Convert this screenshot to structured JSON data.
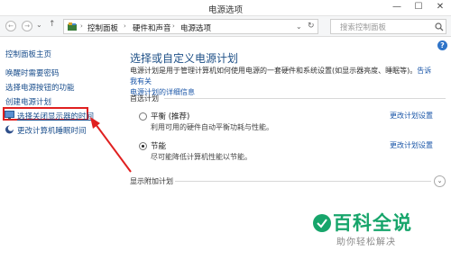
{
  "window": {
    "title": "电源选项",
    "minimize": "—",
    "maximize": "☐",
    "close": "✕"
  },
  "address_bar": {
    "back": "←",
    "forward": "→",
    "history": "⌄",
    "up": "↑",
    "breadcrumbs": [
      "控制面板",
      "硬件和声音",
      "电源选项"
    ],
    "search_placeholder": "搜索控制面板"
  },
  "sidebar": {
    "home": "控制面板主页",
    "items": [
      {
        "label": "唤醒时需要密码"
      },
      {
        "label": "选择电源按钮的功能"
      },
      {
        "label": "创建电源计划"
      },
      {
        "label": "选择关闭显示器的时间"
      },
      {
        "label": "更改计算机睡眠时间"
      }
    ]
  },
  "main": {
    "title": "选择或自定义电源计划",
    "desc_line1": "电源计划是用于管理计算机如何使用电源的一套硬件和系统设置(如显示器亮度、睡眠等)。",
    "desc_link1": "告诉我有关",
    "desc_link2": "电源计划的详细信息",
    "preferred_section": "首选计划",
    "plans": [
      {
        "name": "平衡 (推荐)",
        "desc": "利用可用的硬件自动平衡功耗与性能。",
        "link": "更改计划设置",
        "selected": false
      },
      {
        "name": "节能",
        "desc": "尽可能降低计算机性能以节能。",
        "link": "更改计划设置",
        "selected": true
      }
    ],
    "additional_section": "显示附加计划",
    "expand_glyph": "⌄",
    "help": "?"
  },
  "watermark": {
    "title": "百科全说",
    "subtitle": "助你轻松解决"
  },
  "colors": {
    "link": "#1a4e8c",
    "highlight_red": "#e02020",
    "watermark_green": "#17a56b"
  }
}
